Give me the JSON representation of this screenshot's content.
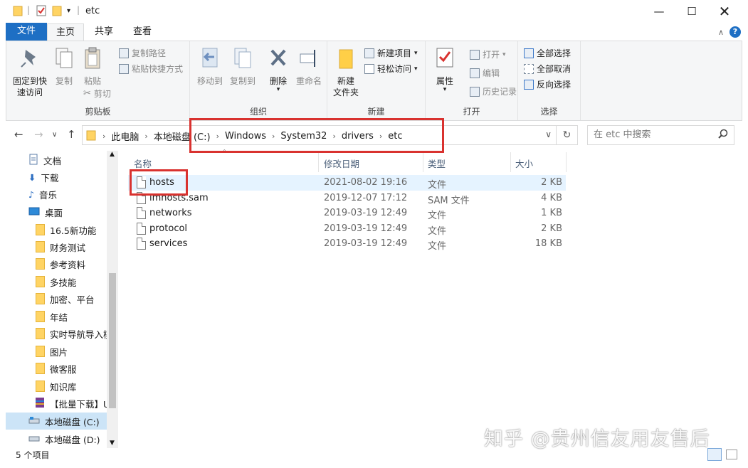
{
  "window": {
    "title": "etc"
  },
  "ribbon_tabs": {
    "file": "文件",
    "home": "主页",
    "share": "共享",
    "view": "查看"
  },
  "ribbon": {
    "clipboard": {
      "label": "剪贴板",
      "pin": "固定到快\n速访问",
      "pin_l1": "固定到快",
      "pin_l2": "速访问",
      "copy": "复制",
      "paste": "粘贴",
      "copy_path": "复制路径",
      "paste_shortcut": "粘贴快捷方式",
      "cut": "剪切"
    },
    "organize": {
      "label": "组织",
      "move_to": "移动到",
      "copy_to": "复制到",
      "delete": "删除",
      "rename": "重命名"
    },
    "new": {
      "label": "新建",
      "new_folder_l1": "新建",
      "new_folder_l2": "文件夹",
      "new_item": "新建项目",
      "easy_access": "轻松访问"
    },
    "open": {
      "label": "打开",
      "properties": "属性",
      "open": "打开",
      "edit": "编辑",
      "history": "历史记录"
    },
    "select": {
      "label": "选择",
      "select_all": "全部选择",
      "select_none": "全部取消",
      "invert": "反向选择"
    }
  },
  "address": {
    "crumbs": [
      "此电脑",
      "本地磁盘 (C:)",
      "Windows",
      "System32",
      "drivers",
      "etc"
    ]
  },
  "search": {
    "placeholder": "在 etc 中搜索"
  },
  "sidebar": {
    "items": [
      {
        "label": "文档",
        "type": "docs"
      },
      {
        "label": "下载",
        "type": "download"
      },
      {
        "label": "音乐",
        "type": "music"
      },
      {
        "label": "桌面",
        "type": "desktop"
      },
      {
        "label": "16.5新功能",
        "type": "folder"
      },
      {
        "label": "财务测试",
        "type": "folder"
      },
      {
        "label": "参考资料",
        "type": "folder"
      },
      {
        "label": "多技能",
        "type": "folder"
      },
      {
        "label": "加密、平台",
        "type": "folder"
      },
      {
        "label": "年结",
        "type": "folder"
      },
      {
        "label": "实时导航导入模",
        "type": "folder"
      },
      {
        "label": "图片",
        "type": "folder"
      },
      {
        "label": "微客服",
        "type": "folder"
      },
      {
        "label": "知识库",
        "type": "folder"
      },
      {
        "label": "【批量下载】U",
        "type": "archive"
      },
      {
        "label": "本地磁盘 (C:)",
        "type": "drive"
      },
      {
        "label": "本地磁盘 (D:)",
        "type": "drive"
      }
    ]
  },
  "columns": {
    "name": "名称",
    "modified": "修改日期",
    "type": "类型",
    "size": "大小"
  },
  "files": [
    {
      "name": "hosts",
      "modified": "2021-08-02 19:16",
      "type": "文件",
      "size": "2 KB"
    },
    {
      "name": "lmhosts.sam",
      "modified": "2019-12-07 17:12",
      "type": "SAM 文件",
      "size": "4 KB"
    },
    {
      "name": "networks",
      "modified": "2019-03-19 12:49",
      "type": "文件",
      "size": "1 KB"
    },
    {
      "name": "protocol",
      "modified": "2019-03-19 12:49",
      "type": "文件",
      "size": "2 KB"
    },
    {
      "name": "services",
      "modified": "2019-03-19 12:49",
      "type": "文件",
      "size": "18 KB"
    }
  ],
  "status": {
    "count": "5 个项目"
  },
  "watermark": "知乎 @贵州信友用友售后",
  "colors": {
    "accent": "#1e6fc4",
    "highlight": "#d9322f",
    "selected_row": "#e5f3ff"
  }
}
